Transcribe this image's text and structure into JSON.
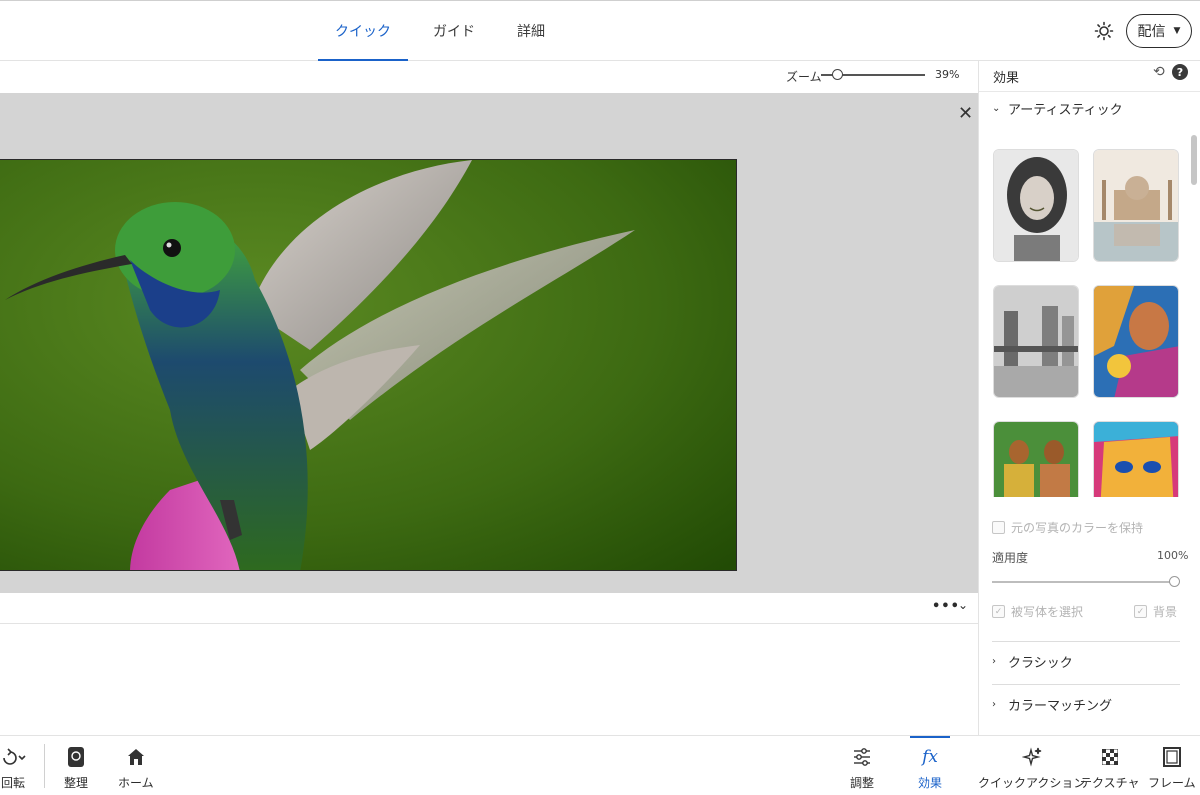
{
  "header": {
    "tabs": [
      {
        "label": "クイック",
        "active": true
      },
      {
        "label": "ガイド",
        "active": false
      },
      {
        "label": "詳細",
        "active": false
      }
    ],
    "share_label": "配信"
  },
  "zoom": {
    "label": "ズーム",
    "value": "39%",
    "level": 0.39
  },
  "effects_panel": {
    "title": "効果",
    "sections": {
      "artistic": "アーティスティック",
      "classic": "クラシック",
      "color_match": "カラーマッチング"
    },
    "thumbnails": [
      {
        "name": "portrait-sketch"
      },
      {
        "name": "taj-mahal-painting"
      },
      {
        "name": "tower-bridge-pencil"
      },
      {
        "name": "woman-colorful-art"
      },
      {
        "name": "tahitian-figures"
      },
      {
        "name": "cubist-face"
      }
    ],
    "keep_color_label": "元の写真のカラーを保持",
    "opacity_label": "適用度",
    "opacity_value": "100%",
    "opacity_level": 1.0,
    "subject_label": "被写体を選択",
    "background_label": "背景"
  },
  "bottom_toolbar": {
    "rotate": "回転",
    "organize": "整理",
    "home": "ホーム",
    "adjust": "調整",
    "effects": "効果",
    "quick_actions": "クイックアクション",
    "texture": "テクスチャ",
    "frame": "フレーム"
  },
  "colors": {
    "accent": "#1a62c9",
    "canvas_bg": "#d4d4d4"
  }
}
